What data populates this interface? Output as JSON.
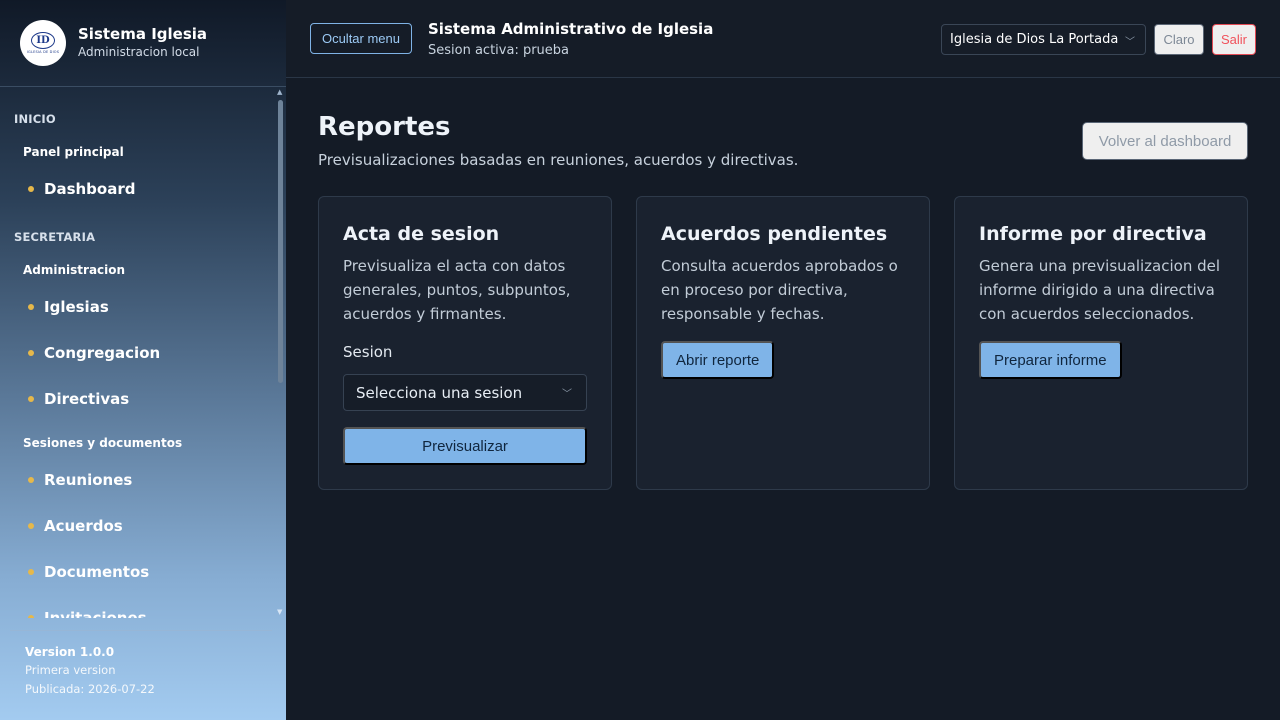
{
  "brand": {
    "logo_text": "ID",
    "logo_caption": "IGLESIA DE DIOS",
    "title": "Sistema Iglesia",
    "subtitle": "Administracion local"
  },
  "sidebar": {
    "sections": [
      {
        "label": "INICIO"
      },
      {
        "label": "SECRETARIA"
      }
    ],
    "groups": [
      {
        "label": "Panel principal"
      },
      {
        "label": "Administracion"
      },
      {
        "label": "Sesiones y documentos"
      }
    ],
    "items": [
      {
        "label": "Dashboard"
      },
      {
        "label": "Iglesias"
      },
      {
        "label": "Congregacion"
      },
      {
        "label": "Directivas"
      },
      {
        "label": "Reuniones"
      },
      {
        "label": "Acuerdos"
      },
      {
        "label": "Documentos"
      },
      {
        "label": "Invitaciones"
      }
    ],
    "version": {
      "title": "Version 1.0.0",
      "note": "Primera version",
      "published": "Publicada: 2026-07-22"
    }
  },
  "topbar": {
    "hide_menu_label": "Ocultar menu",
    "title": "Sistema Administrativo de Iglesia",
    "session": "Sesion activa: prueba",
    "church_selected": "Iglesia de Dios La Portada",
    "theme_label": "Claro",
    "logout_label": "Salir"
  },
  "main": {
    "title": "Reportes",
    "subtitle": "Previsualizaciones basadas en reuniones, acuerdos y directivas.",
    "back_label": "Volver al dashboard",
    "cards": [
      {
        "title": "Acta de sesion",
        "description": "Previsualiza el acta con datos generales, puntos, subpuntos, acuerdos y firmantes.",
        "field_label": "Sesion",
        "select_placeholder": "Selecciona una sesion",
        "button_label": "Previsualizar"
      },
      {
        "title": "Acuerdos pendientes",
        "description": "Consulta acuerdos aprobados o en proceso por directiva, responsable y fechas.",
        "button_label": "Abrir reporte"
      },
      {
        "title": "Informe por directiva",
        "description": "Genera una previsualizacion del informe dirigido a una directiva con acuerdos seleccionados.",
        "button_label": "Preparar informe"
      }
    ]
  },
  "colors": {
    "accent": "#7fb4e8",
    "danger": "#e24a54",
    "nav_dot": "#e6b84a",
    "background": "#141b26",
    "card": "#1a222f"
  },
  "icons": {
    "select_chevron": "chevron-down-icon",
    "scroll_up": "scroll-up-arrow-icon",
    "scroll_down": "scroll-down-arrow-icon"
  }
}
